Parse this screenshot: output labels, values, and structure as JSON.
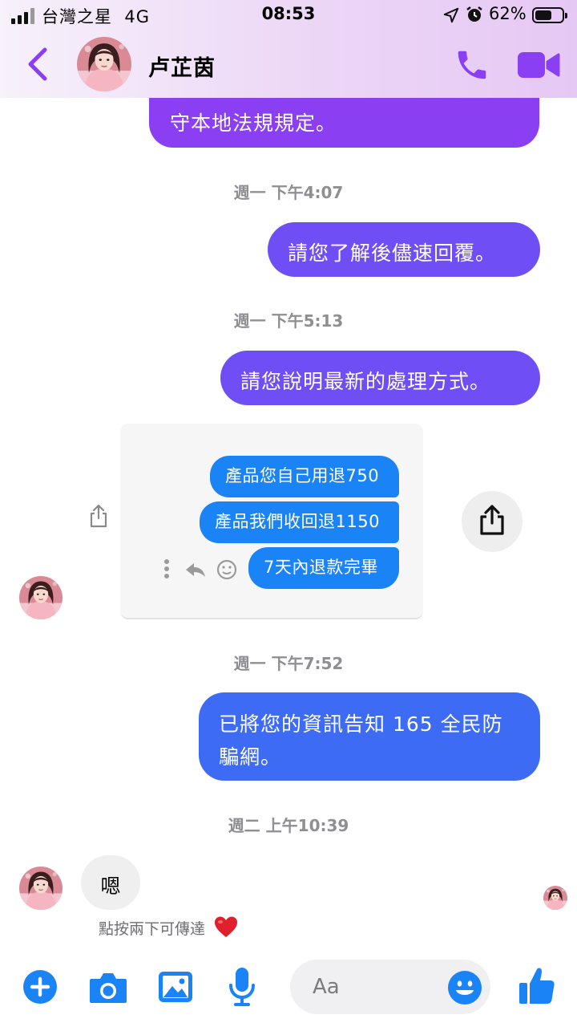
{
  "status_bar": {
    "carrier": "台灣之星",
    "network": "4G",
    "time": "08:53",
    "battery_percent_text": "62%",
    "battery_level": 0.62,
    "icons": [
      "signal-icon",
      "location-icon",
      "alarm-icon",
      "battery-icon"
    ]
  },
  "header": {
    "contact_name": "卢芷茵",
    "back_icon": "chevron-left-icon",
    "call_icon": "phone-icon",
    "video_icon": "video-camera-icon",
    "accent_color": "#8b3ff2"
  },
  "messages": [
    {
      "sender": "me",
      "text": "守本地法規規定。"
    },
    {
      "type": "timestamp",
      "text": "週一 下午4:07"
    },
    {
      "sender": "me",
      "text": "請您了解後儘速回覆。"
    },
    {
      "type": "timestamp",
      "text": "週一 下午5:13"
    },
    {
      "sender": "me",
      "text": "請您說明最新的處理方式。"
    },
    {
      "sender": "contact",
      "type": "shared_image",
      "inner_messages": [
        "產品您自己用退750",
        "產品我們收回退1150",
        "7天內退款完畢"
      ]
    },
    {
      "type": "timestamp",
      "text": "週一 下午7:52"
    },
    {
      "sender": "me",
      "text_line1": "已將您的資訊告知 165 全民防",
      "text_line2": "騙網。"
    },
    {
      "type": "timestamp",
      "text": "週二 上午10:39"
    },
    {
      "sender": "contact",
      "text": "嗯"
    }
  ],
  "reaction_hint": "點按兩下可傳達",
  "composer": {
    "placeholder": "Aa",
    "icons": [
      "plus-icon",
      "camera-icon",
      "image-icon",
      "microphone-icon",
      "emoji-icon",
      "thumbs-up-icon"
    ],
    "accent_color": "#1a84f6"
  },
  "colors": {
    "bubble_purple": "#8b3ff2",
    "bubble_violet": "#6f4ef5",
    "bubble_blue": "#3d6bf3",
    "received_bubble": "#efefef",
    "heart": "#e0202e"
  }
}
